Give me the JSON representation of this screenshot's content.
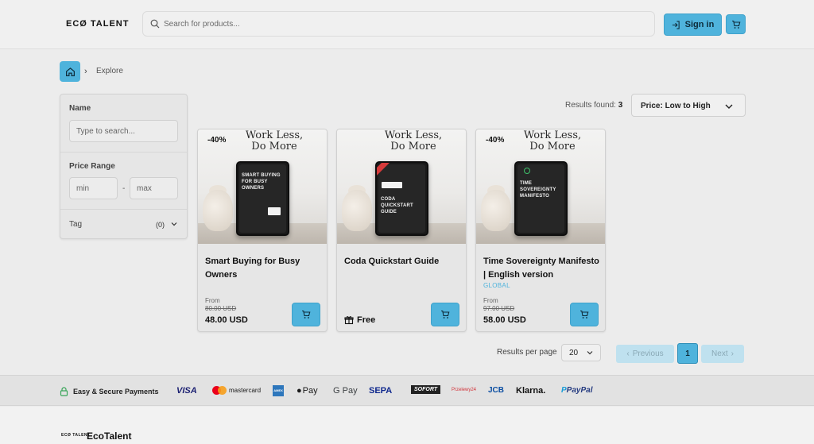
{
  "header": {
    "logo": "ECØ TALENT",
    "search_placeholder": "Search for products...",
    "signin_label": "Sign in"
  },
  "breadcrumb": {
    "current": "Explore"
  },
  "filters": {
    "name_title": "Name",
    "name_placeholder": "Type to search...",
    "price_title": "Price Range",
    "min_placeholder": "min",
    "max_placeholder": "max",
    "dash": "-",
    "tag_title": "Tag",
    "tag_count": "(0)"
  },
  "results": {
    "label": "Results found:",
    "count": "3",
    "sort_selected": "Price: Low to High"
  },
  "products": [
    {
      "discount": "-40%",
      "headline_1": "Work Less,",
      "headline_2": "Do More",
      "cover_title": "SMART BUYING FOR BUSY OWNERS",
      "name": "Smart Buying for Busy Owners",
      "from": "From",
      "old_price": "80.00 USD",
      "price": "48.00 USD"
    },
    {
      "headline_1": "Work Less,",
      "headline_2": "Do More",
      "cover_title": "CODA QUICKSTART GUIDE",
      "name": "Coda Quickstart Guide",
      "price": "Free"
    },
    {
      "discount": "-40%",
      "headline_1": "Work Less,",
      "headline_2": "Do More",
      "cover_title": "TIME SOVEREIGNTY MANIFESTO",
      "name": "Time Sovereignty Manifesto | English version",
      "tag": "GLOBAL",
      "from": "From",
      "old_price": "97.00 USD",
      "price": "58.00 USD"
    }
  ],
  "pagination": {
    "rpp_label": "Results per page",
    "rpp_value": "20",
    "prev": "Previous",
    "page": "1",
    "next": "Next"
  },
  "payments": {
    "secure_label": "Easy & Secure Payments",
    "methods": [
      "VISA",
      "mastercard",
      "AMEX",
      "Pay",
      "G Pay",
      "SEPA",
      "SOFORT",
      "Przelewy24",
      "JCB",
      "Klarna.",
      "PayPal"
    ]
  },
  "footer": {
    "logo": "ECØ TALENT",
    "brand": "EcoTalent"
  },
  "colors": {
    "accent": "#4fb3dc",
    "accent_light": "#bfe1ef"
  }
}
